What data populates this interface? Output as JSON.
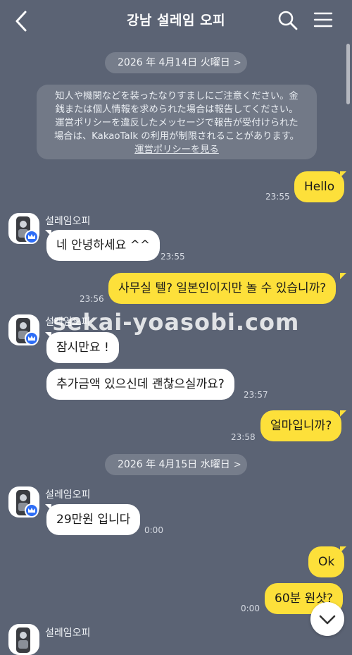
{
  "header": {
    "title": "강남 설레임 오피",
    "back_icon": "back-chevron-icon",
    "search_icon": "search-icon",
    "menu_icon": "hamburger-menu-icon"
  },
  "dates": [
    {
      "label": "2026 年 4月14日 火曜日"
    },
    {
      "label": "2026 年 4月15日 水曜日"
    }
  ],
  "notice": {
    "lines": [
      "知人や機関などを装ったなりすましにご注意ください。金",
      "銭または個人情報を求められた場合は報告してください。",
      "運営ポリシーを違反したメッセージで報告が受付けられた",
      "場合は、KakaoTalk の利用が制限されることがあります。"
    ],
    "link": "運営ポリシーを見る"
  },
  "sender_name": "설레임오피",
  "watermark": "sekai-yoasobi.com",
  "messages": [
    {
      "text": "Hello",
      "time": "23:55"
    },
    {
      "text": "네 안녕하세요 ^^",
      "time": "23:55"
    },
    {
      "text": "사무실 텔? 일본인이지만 놀 수 있습니까?",
      "time": "23:56"
    },
    {
      "text": "잠시만요 !",
      "time": ""
    },
    {
      "text": "추가금액 있으신데 괜찮으실까요?",
      "time": "23:57"
    },
    {
      "text": "얼마입니까?",
      "time": "23:58"
    },
    {
      "text": "29만원 입니다",
      "time": "0:00"
    },
    {
      "text": "Ok",
      "time": ""
    },
    {
      "text": "60분 원샷?",
      "time": "0:00"
    }
  ],
  "colors": {
    "background": "#5b6374",
    "my_bubble": "#fde03a",
    "other_bubble": "#ffffff",
    "badge": "#2d6df6"
  }
}
